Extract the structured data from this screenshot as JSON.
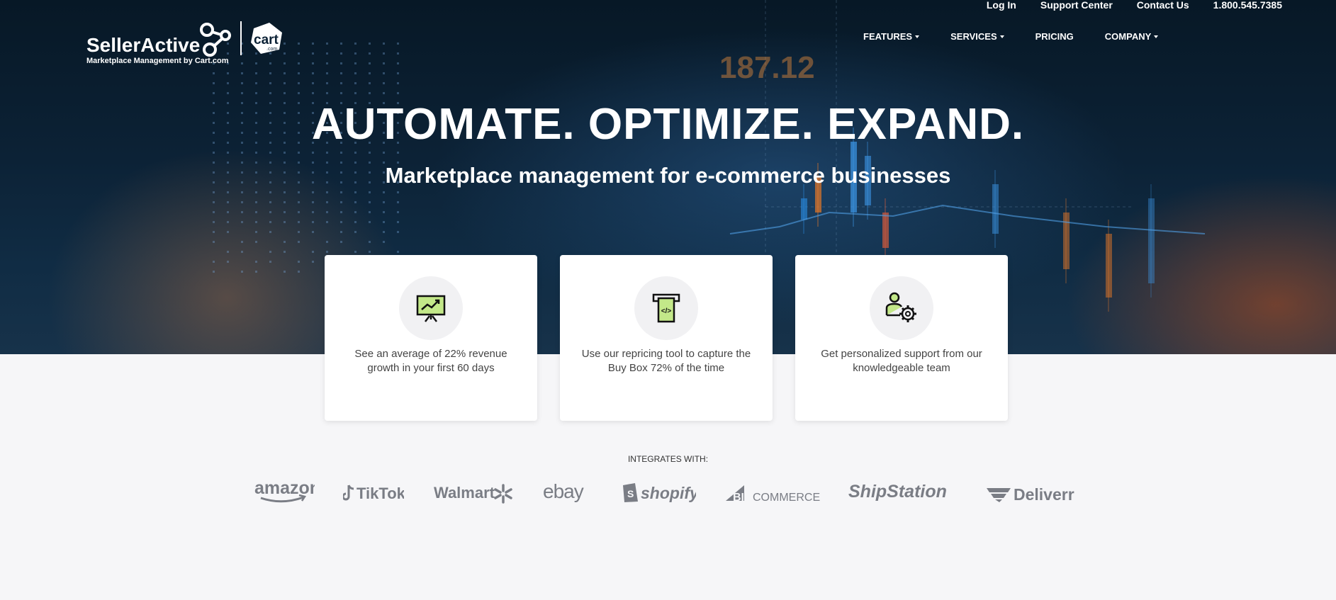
{
  "topbar": {
    "login": "Log In",
    "support": "Support Center",
    "contact": "Contact Us",
    "phone": "1.800.545.7385"
  },
  "logo": {
    "brand": "SellerActive",
    "tagline": "Marketplace Management by Cart.com",
    "partner": "cart",
    "partner_suffix": ".com"
  },
  "nav": {
    "features": "FEATURES",
    "services": "SERVICES",
    "pricing": "PRICING",
    "company": "COMPANY"
  },
  "hero": {
    "title": "AUTOMATE. OPTIMIZE. EXPAND.",
    "subtitle": "Marketplace management for e-commerce businesses",
    "bg_number": "187.12"
  },
  "cards": [
    {
      "icon": "chart-presentation-icon",
      "text": "See an average of 22% revenue growth in your first 60 days"
    },
    {
      "icon": "buy-box-price-tag-icon",
      "text": "Use our repricing tool to capture the Buy Box 72% of the time"
    },
    {
      "icon": "support-gear-person-icon",
      "text": "Get personalized support from our knowledgeable team"
    }
  ],
  "integrations": {
    "label": "INTEGRATES WITH:",
    "logos": {
      "amazon": "amazon",
      "tiktok": "TikTok",
      "walmart": "Walmart",
      "ebay": "ebay",
      "shopify": "shopify",
      "bigcommerce_big": "BIG",
      "bigcommerce_rest": "COMMERCE",
      "shipstation": "ShipStation",
      "deliverr": "Deliverr"
    }
  },
  "colors": {
    "card_icon_fill": "#c3e889",
    "logo_gray": "#7a7d85",
    "page_bg": "#f6f6f8"
  }
}
